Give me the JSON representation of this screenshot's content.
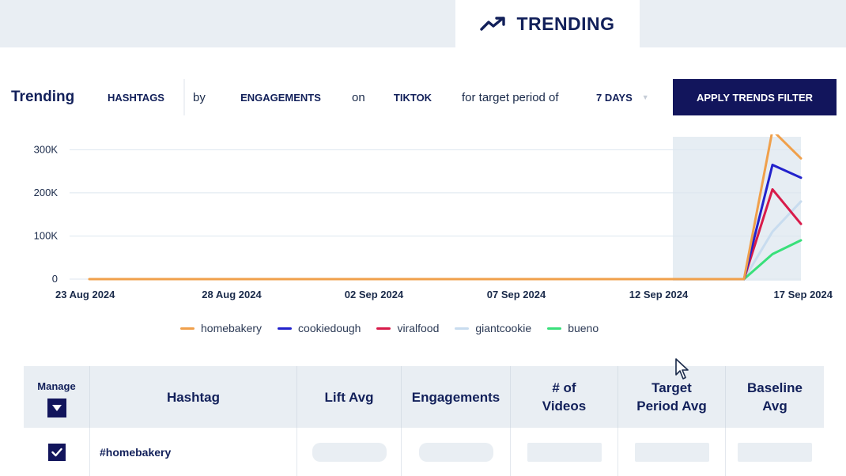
{
  "header": {
    "tab_label": "TRENDING",
    "tab_icon": "trending-up-icon"
  },
  "filters": {
    "title": "Trending",
    "type_value": "HASHTAGS",
    "by_word": "by",
    "metric_value": "ENGAGEMENTS",
    "on_word": "on",
    "platform_value": "TIKTOK",
    "period_word": "for target period of",
    "period_value": "7 DAYS",
    "apply_label": "APPLY TRENDS FILTER"
  },
  "chart_data": {
    "type": "line",
    "x": [
      "23 Aug 2024",
      "24 Aug 2024",
      "25 Aug 2024",
      "26 Aug 2024",
      "27 Aug 2024",
      "28 Aug 2024",
      "29 Aug 2024",
      "30 Aug 2024",
      "31 Aug 2024",
      "01 Sep 2024",
      "02 Sep 2024",
      "03 Sep 2024",
      "04 Sep 2024",
      "05 Sep 2024",
      "06 Sep 2024",
      "07 Sep 2024",
      "08 Sep 2024",
      "09 Sep 2024",
      "10 Sep 2024",
      "11 Sep 2024",
      "12 Sep 2024",
      "13 Sep 2024",
      "14 Sep 2024",
      "15 Sep 2024",
      "16 Sep 2024",
      "17 Sep 2024"
    ],
    "x_ticks": [
      "23 Aug 2024",
      "28 Aug 2024",
      "02 Sep 2024",
      "07 Sep 2024",
      "12 Sep 2024",
      "17 Sep 2024"
    ],
    "y_ticks": [
      {
        "value": 0,
        "label": "0"
      },
      {
        "value": 100000,
        "label": "100K"
      },
      {
        "value": 200000,
        "label": "200K"
      },
      {
        "value": 300000,
        "label": "300K"
      }
    ],
    "ylim": [
      0,
      330000
    ],
    "highlight_range": [
      "13 Sep 2024",
      "17 Sep 2024"
    ],
    "grid": true,
    "legend_position": "bottom",
    "series": [
      {
        "name": "homebakery",
        "color": "#f0a04b",
        "values": [
          0,
          0,
          0,
          0,
          0,
          0,
          0,
          0,
          0,
          0,
          0,
          0,
          0,
          0,
          0,
          0,
          0,
          0,
          0,
          0,
          0,
          0,
          0,
          0,
          345000,
          280000
        ]
      },
      {
        "name": "cookiedough",
        "color": "#2222cc",
        "values": [
          null,
          null,
          null,
          null,
          null,
          null,
          null,
          null,
          null,
          null,
          null,
          null,
          null,
          null,
          null,
          null,
          null,
          null,
          null,
          null,
          null,
          0,
          0,
          0,
          265000,
          235000
        ]
      },
      {
        "name": "viralfood",
        "color": "#d81b4a",
        "values": [
          null,
          null,
          null,
          null,
          null,
          null,
          null,
          null,
          null,
          null,
          null,
          null,
          null,
          null,
          null,
          null,
          null,
          null,
          null,
          null,
          null,
          0,
          0,
          0,
          208000,
          128000
        ]
      },
      {
        "name": "giantcookie",
        "color": "#c8dcef",
        "values": [
          null,
          null,
          null,
          null,
          null,
          null,
          null,
          null,
          null,
          null,
          null,
          null,
          null,
          null,
          null,
          null,
          null,
          null,
          null,
          null,
          null,
          null,
          null,
          0,
          110000,
          180000
        ]
      },
      {
        "name": "bueno",
        "color": "#39e07a",
        "values": [
          null,
          null,
          null,
          null,
          null,
          null,
          null,
          null,
          null,
          null,
          null,
          null,
          null,
          null,
          null,
          null,
          null,
          null,
          null,
          null,
          null,
          null,
          null,
          0,
          58000,
          90000
        ]
      }
    ]
  },
  "table": {
    "headers": {
      "manage": "Manage",
      "hashtag": "Hashtag",
      "lift": "Lift Avg",
      "engagements": "Engagements",
      "videos_1": "# of",
      "videos_2": "Videos",
      "target_1": "Target",
      "target_2": "Period Avg",
      "baseline_1": "Baseline",
      "baseline_2": "Avg"
    },
    "rows": [
      {
        "checked": true,
        "hashtag": "#homebakery"
      }
    ]
  }
}
